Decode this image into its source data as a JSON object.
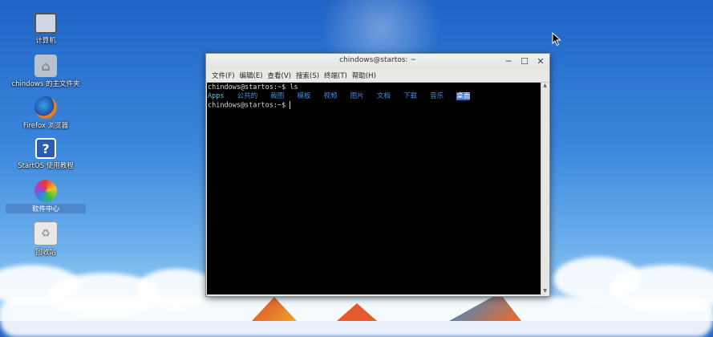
{
  "desktop_icons": [
    {
      "label": "计算机",
      "icon": "computer-icon"
    },
    {
      "label": "chindows 的主文件夹",
      "icon": "home-folder-icon"
    },
    {
      "label": "Firefox 浏览器",
      "icon": "firefox-icon"
    },
    {
      "label": "StartOS 使用教程",
      "icon": "help-icon"
    },
    {
      "label": "软件中心",
      "icon": "software-center-icon"
    },
    {
      "label": "回收站",
      "icon": "trash-icon"
    }
  ],
  "window": {
    "title": "chindows@startos: ~",
    "menu": [
      "文件(F)",
      "编辑(E)",
      "查看(V)",
      "搜索(S)",
      "终端(T)",
      "帮助(H)"
    ]
  },
  "terminal": {
    "line1": "chindows@startos:~$ ls",
    "ls_entries": [
      "Apps",
      "公共的",
      "截图",
      "模板",
      "视频",
      "图片",
      "文档",
      "下载",
      "音乐",
      "桌面"
    ],
    "line3": "chindows@startos:~$ "
  }
}
